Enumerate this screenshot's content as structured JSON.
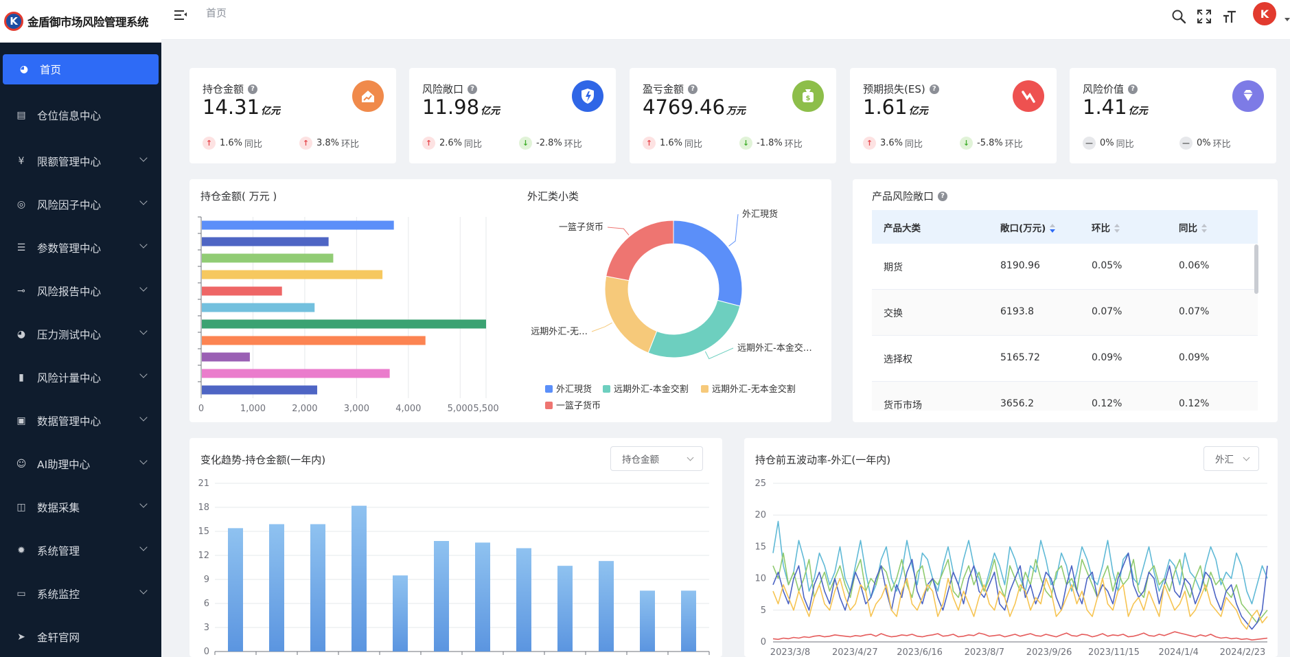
{
  "app": {
    "title": "金盾御市场风险管理系统",
    "logo_letter": "K"
  },
  "header": {
    "breadcrumb": "首页",
    "avatar_letter": "K"
  },
  "sidebar": {
    "items": [
      {
        "label": "首页",
        "icon": "dashboard-icon",
        "active": true,
        "expandable": false
      },
      {
        "label": "仓位信息中心",
        "icon": "database-icon",
        "active": false,
        "expandable": false
      },
      {
        "label": "限额管理中心",
        "icon": "yen-icon",
        "active": false,
        "expandable": true
      },
      {
        "label": "风险因子中心",
        "icon": "factor-icon",
        "active": false,
        "expandable": true
      },
      {
        "label": "参数管理中心",
        "icon": "sliders-icon",
        "active": false,
        "expandable": true
      },
      {
        "label": "风险报告中心",
        "icon": "report-icon",
        "active": false,
        "expandable": true
      },
      {
        "label": "压力测试中心",
        "icon": "gauge-icon",
        "active": false,
        "expandable": true
      },
      {
        "label": "风险计量中心",
        "icon": "bar-chart-icon",
        "active": false,
        "expandable": true
      },
      {
        "label": "数据管理中心",
        "icon": "data-icon",
        "active": false,
        "expandable": true
      },
      {
        "label": "AI助理中心",
        "icon": "robot-icon",
        "active": false,
        "expandable": true
      },
      {
        "label": "数据采集",
        "icon": "book-icon",
        "active": false,
        "expandable": true
      },
      {
        "label": "系统管理",
        "icon": "gear-icon",
        "active": false,
        "expandable": true
      },
      {
        "label": "系统监控",
        "icon": "monitor-icon",
        "active": false,
        "expandable": true
      },
      {
        "label": "金轩官网",
        "icon": "send-icon",
        "active": false,
        "expandable": false
      }
    ]
  },
  "kpis": [
    {
      "title": "持仓金额",
      "value": "14.31",
      "unit": "亿元",
      "icon": "home-chart-icon",
      "color": "#f08a4b",
      "yoy": {
        "dir": "up",
        "text": "1.6%",
        "label": "同比"
      },
      "mom": {
        "dir": "up",
        "text": "3.8%",
        "label": "环比"
      }
    },
    {
      "title": "风险敞口",
      "value": "11.98",
      "unit": "亿元",
      "icon": "shield-icon",
      "color": "#2f66e6",
      "yoy": {
        "dir": "up",
        "text": "2.6%",
        "label": "同比"
      },
      "mom": {
        "dir": "down",
        "text": "-2.8%",
        "label": "环比"
      }
    },
    {
      "title": "盈亏金额",
      "value": "4769.46",
      "unit": "万元",
      "icon": "money-bag-icon",
      "color": "#8dbe4a",
      "yoy": {
        "dir": "up",
        "text": "1.6%",
        "label": "同比"
      },
      "mom": {
        "dir": "down",
        "text": "-1.8%",
        "label": "环比"
      }
    },
    {
      "title": "预期损失(ES)",
      "value": "1.61",
      "unit": "亿元",
      "icon": "loss-icon",
      "color": "#ee5150",
      "yoy": {
        "dir": "up",
        "text": "3.6%",
        "label": "同比"
      },
      "mom": {
        "dir": "down",
        "text": "-5.8%",
        "label": "环比"
      }
    },
    {
      "title": "风险价值",
      "value": "1.41",
      "unit": "亿元",
      "icon": "diamond-icon",
      "color": "#7d7be6",
      "yoy": {
        "dir": "flat",
        "text": "0%",
        "label": "同比"
      },
      "mom": {
        "dir": "flat",
        "text": "0%",
        "label": "环比"
      }
    }
  ],
  "panels": {
    "position_bar_title": "持仓金额( 万元 )",
    "fx_donut_title": "外汇类小类",
    "exposure_title": "产品风险敞口",
    "trend_title": "变化趋势-持仓金额(一年内)",
    "trend_select": "持仓金额",
    "vol_title": "持仓前五波动率-外汇(一年内)",
    "vol_select": "外汇"
  },
  "exposure_table": {
    "headers": [
      "产品大类",
      "敞口(万元)",
      "环比",
      "同比"
    ],
    "rows": [
      [
        "期货",
        "8190.96",
        "0.05%",
        "0.06%"
      ],
      [
        "交换",
        "6193.8",
        "0.07%",
        "0.07%"
      ],
      [
        "选择权",
        "5165.72",
        "0.09%",
        "0.09%"
      ],
      [
        "货币市场",
        "3656.2",
        "0.12%",
        "0.12%"
      ]
    ]
  },
  "chart_data": [
    {
      "type": "bar",
      "orientation": "horizontal",
      "title": "持仓金额( 万元 )",
      "values": [
        3720,
        2460,
        2550,
        3500,
        1560,
        2190,
        5500,
        4330,
        940,
        3640,
        2240
      ],
      "colors": [
        "#5b8ff9",
        "#4e65c4",
        "#91cc75",
        "#f6c85f",
        "#ee6666",
        "#73c0de",
        "#3ba272",
        "#fc8452",
        "#9a60b4",
        "#ea7ccc",
        "#4e65c4"
      ],
      "xticks": [
        0,
        1000,
        2000,
        3000,
        4000,
        5000,
        5500
      ],
      "xtick_labels": [
        "0",
        "1,000",
        "2,000",
        "3,000",
        "4,000",
        "5,000",
        "5,500"
      ],
      "xlim": [
        0,
        5500
      ]
    },
    {
      "type": "pie",
      "title": "外汇类小类",
      "labels": [
        "外汇現货",
        "远期外汇-本金交…",
        "远期外汇-无…",
        "一篮子货币"
      ],
      "legend": [
        "外汇現货",
        "远期外汇-本金交割",
        "远期外汇-无本金交割",
        "一篮子货币"
      ],
      "values": [
        29,
        27,
        22,
        22
      ],
      "colors": [
        "#5b8ff9",
        "#6dcfbf",
        "#f6c97a",
        "#ee7571"
      ]
    },
    {
      "type": "bar",
      "title": "变化趋势-持仓金额(一年内)",
      "values": [
        15.4,
        15.9,
        15.9,
        18.2,
        9.5,
        13.8,
        13.6,
        12.9,
        10.7,
        11.3,
        7.6,
        7.6
      ],
      "yticks": [
        0,
        3,
        6,
        9,
        12,
        15,
        18,
        21
      ],
      "ylim": [
        0,
        21
      ],
      "color": "#6da5e8"
    },
    {
      "type": "line",
      "title": "持仓前五波动率-外汇(一年内)",
      "xtick_labels": [
        "2023/3/8",
        "2023/4/27",
        "2023/6/16",
        "2023/8/7",
        "2023/9/26",
        "2023/11/15",
        "2024/1/4",
        "2024/2/23"
      ],
      "yticks": [
        0,
        5,
        10,
        15,
        20,
        25
      ],
      "ylim": [
        0,
        25
      ],
      "series": [
        {
          "color": "#5fb9d6",
          "values": [
            14,
            19,
            12,
            9,
            11,
            16,
            13,
            8,
            10,
            14,
            12,
            9,
            11,
            15,
            10,
            8,
            12,
            16,
            11,
            7,
            9,
            13,
            15,
            10,
            8,
            11,
            16,
            12,
            9,
            14,
            13,
            10,
            8,
            12,
            15,
            11,
            9,
            13,
            16,
            12,
            10,
            8,
            11,
            14,
            12,
            9,
            15,
            13,
            10,
            8,
            12,
            11,
            16,
            13,
            9,
            10,
            14,
            12,
            8,
            11,
            15,
            13,
            10,
            9,
            12,
            16,
            11,
            8,
            13,
            14,
            10,
            9,
            12,
            15,
            11,
            8,
            10,
            13,
            12,
            9,
            14,
            11,
            10,
            8,
            12,
            15,
            13,
            9,
            11,
            10,
            14,
            12,
            8,
            6,
            9,
            12,
            10
          ]
        },
        {
          "color": "#8fca6e",
          "values": [
            12,
            10,
            14,
            9,
            11,
            8,
            10,
            13,
            7,
            9,
            11,
            8,
            10,
            12,
            9,
            7,
            11,
            13,
            8,
            10,
            9,
            12,
            11,
            8,
            10,
            13,
            9,
            7,
            11,
            12,
            8,
            10,
            9,
            11,
            13,
            8,
            7,
            10,
            12,
            9,
            11,
            8,
            10,
            13,
            9,
            7,
            12,
            10,
            8,
            11,
            9,
            13,
            10,
            8,
            7,
            11,
            12,
            9,
            10,
            8,
            13,
            11,
            9,
            7,
            10,
            12,
            8,
            11,
            9,
            10,
            13,
            8,
            7,
            11,
            12,
            9,
            10,
            8,
            11,
            13,
            9,
            7,
            10,
            12,
            8,
            11,
            9,
            10,
            8,
            7,
            9,
            6,
            5,
            4,
            3,
            4,
            5
          ]
        },
        {
          "color": "#4b63c4",
          "values": [
            9,
            11,
            8,
            6,
            10,
            12,
            7,
            5,
            9,
            11,
            8,
            6,
            10,
            7,
            5,
            8,
            11,
            9,
            6,
            7,
            10,
            12,
            8,
            5,
            9,
            7,
            11,
            13,
            8,
            6,
            9,
            10,
            7,
            5,
            8,
            11,
            9,
            6,
            10,
            12,
            8,
            7,
            9,
            11,
            6,
            5,
            8,
            10,
            12,
            7,
            9,
            6,
            8,
            11,
            10,
            7,
            5,
            9,
            12,
            8,
            6,
            10,
            11,
            7,
            9,
            8,
            6,
            10,
            12,
            14,
            9,
            7,
            8,
            11,
            10,
            6,
            9,
            12,
            8,
            7,
            10,
            9,
            6,
            8,
            11,
            10,
            7,
            5,
            8,
            9,
            6,
            4,
            3,
            2,
            3,
            5,
            12
          ]
        },
        {
          "color": "#f6c452",
          "values": [
            8,
            6,
            9,
            7,
            5,
            8,
            6,
            4,
            7,
            9,
            6,
            5,
            8,
            10,
            7,
            5,
            6,
            9,
            8,
            4,
            6,
            7,
            9,
            5,
            4,
            8,
            10,
            6,
            5,
            7,
            9,
            8,
            4,
            6,
            10,
            7,
            5,
            8,
            6,
            4,
            7,
            9,
            6,
            5,
            8,
            7,
            4,
            6,
            9,
            8,
            5,
            7,
            6,
            10,
            8,
            4,
            5,
            7,
            9,
            6,
            8,
            5,
            4,
            7,
            10,
            6,
            5,
            8,
            9,
            4,
            6,
            7,
            5,
            8,
            6,
            4,
            9,
            7,
            5,
            6,
            8,
            4,
            5,
            7,
            9,
            6,
            5,
            4,
            7,
            6,
            5,
            3,
            2,
            4,
            5,
            3,
            4
          ]
        },
        {
          "color": "#e55b5b",
          "values": [
            0.5,
            0.4,
            0.6,
            0.5,
            0.7,
            0.6,
            0.8,
            0.7,
            0.9,
            1.0,
            0.8,
            0.9,
            1.1,
            1.0,
            0.9,
            0.8,
            1.0,
            0.9,
            1.1,
            1.2,
            0.9,
            1.3,
            1.0,
            0.8,
            0.9,
            1.1,
            1.0,
            1.2,
            0.9,
            0.8,
            1.0,
            1.1,
            1.3,
            0.9,
            1.0,
            1.2,
            0.8,
            0.9,
            1.1,
            1.0,
            1.4,
            1.2,
            0.9,
            1.0,
            1.1,
            0.8,
            1.0,
            1.2,
            0.9,
            1.1,
            1.3,
            1.0,
            0.9,
            1.2,
            1.0,
            0.8,
            1.1,
            1.4,
            1.0,
            0.9,
            1.2,
            1.1,
            0.8,
            1.0,
            1.3,
            0.9,
            1.1,
            1.0,
            1.2,
            0.8,
            0.9,
            1.1,
            1.4,
            1.0,
            0.9,
            1.2,
            1.0,
            1.3,
            1.6,
            1.4,
            1.2,
            1.0,
            0.8,
            1.1,
            0.9,
            1.2,
            0.8,
            0.6,
            0.7,
            0.5,
            0.6,
            0.4,
            0.5,
            0.3,
            0.4,
            0.5,
            0.6
          ]
        }
      ]
    }
  ]
}
